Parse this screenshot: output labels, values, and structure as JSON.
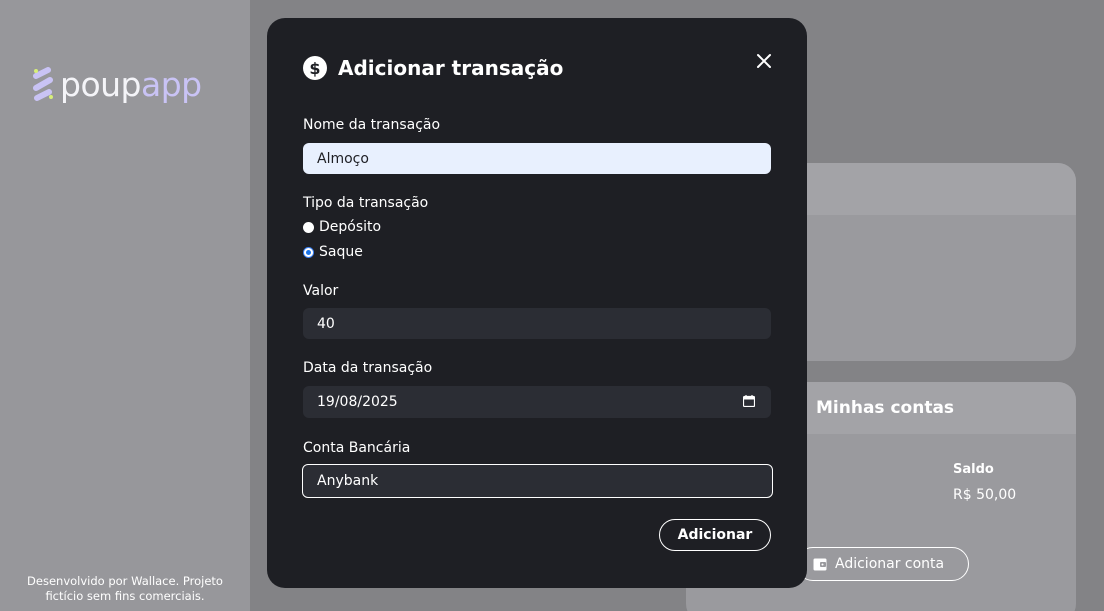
{
  "sidebar": {
    "logo": {
      "part1": "poup",
      "part2": "app"
    },
    "footer": {
      "line1": "Desenvolvido por Wallace. Projeto",
      "line2": "fictício sem fins comerciais."
    }
  },
  "accounts_card": {
    "title": "Minhas contas",
    "saldo_label": "Saldo",
    "saldo_value": "R$ 50,00",
    "add_button": "Adicionar conta"
  },
  "modal": {
    "title": "Adicionar transação",
    "icon": "dollar-circle-icon",
    "fields": {
      "name": {
        "label": "Nome da transação",
        "value": "Almoço"
      },
      "type": {
        "label": "Tipo da transação",
        "options": [
          {
            "label": "Depósito",
            "checked": false
          },
          {
            "label": "Saque",
            "checked": true
          }
        ]
      },
      "amount": {
        "label": "Valor",
        "value": "40"
      },
      "date": {
        "label": "Data da transação",
        "value": "19/08/2025"
      },
      "account": {
        "label": "Conta Bancária",
        "value": "Anybank"
      }
    },
    "submit_label": "Adicionar"
  },
  "colors": {
    "modal_bg": "#1e1f24",
    "input_dark": "#2b2d34",
    "input_autofill": "#e8f0fe",
    "overlay": "#838386",
    "logo_accent": "#c9c3f5"
  }
}
